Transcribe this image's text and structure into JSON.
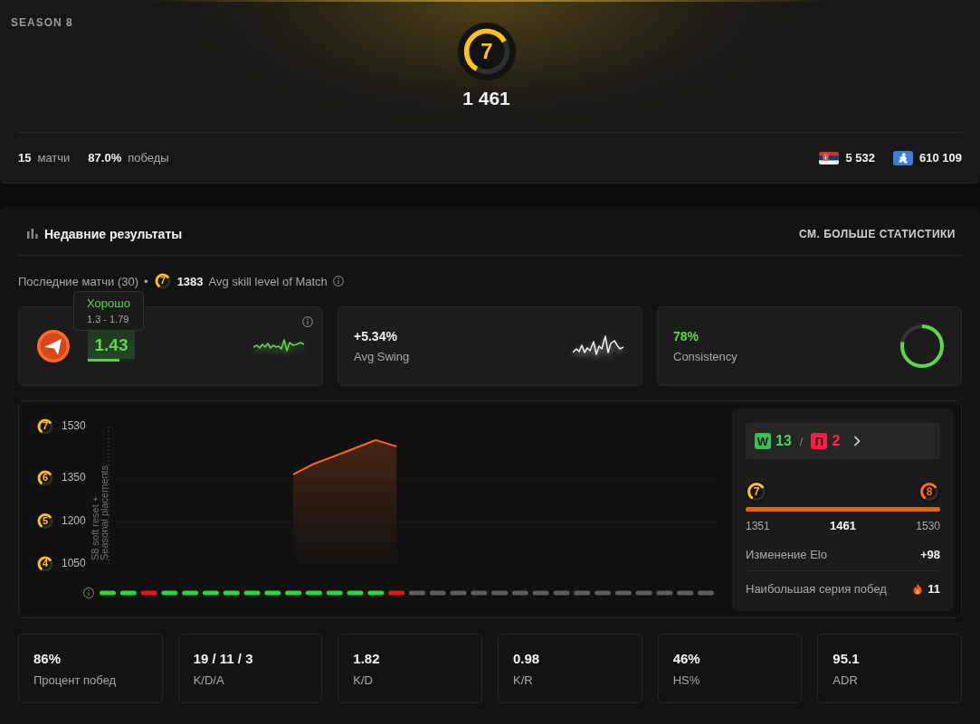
{
  "season_card": {
    "season": "SEASON 8",
    "skill_level": {
      "label": "7",
      "color": "#ffc21a"
    },
    "elo": "1 461",
    "totals": [
      {
        "number": "15",
        "unit": "матчи"
      },
      {
        "number": "87.0%",
        "unit": "победы"
      }
    ],
    "rankings": [
      {
        "kind": "country",
        "value": "5 532"
      },
      {
        "kind": "region",
        "value": "610 109"
      }
    ]
  },
  "recent_results": {
    "title": "Недавние результаты",
    "more_stats_link": "СМ. БОЛЬШЕ СТАТИСТИКИ",
    "summary": {
      "matches_label": "Последние матчи (30)",
      "separator": "•",
      "skill_level": {
        "label": "7",
        "color": "#ffc21a"
      },
      "avg_elo": "1383",
      "avg_label": "Avg skill level of Match"
    },
    "highlight_cards": [
      {
        "kind": "rating",
        "value": "1.43",
        "level": 0.68,
        "tooltip": {
          "title": "Хорошо",
          "range": "1.3 - 1.79"
        }
      },
      {
        "kind": "swing",
        "value": "+5.34%",
        "label": "Avg Swing"
      },
      {
        "kind": "consistency",
        "value": "78%",
        "label": "Consistency",
        "level": 0.78
      }
    ],
    "elo_chart": {
      "tick_levels": [
        {
          "label": "7",
          "color": "#ffc21a"
        },
        {
          "label": "6",
          "color": "#ffc21a"
        },
        {
          "label": "5",
          "color": "#ffc21a"
        },
        {
          "label": "4",
          "color": "#ffc21a"
        }
      ],
      "note_lines": [
        "S8 soft reset +",
        "Seasonal placements"
      ],
      "chart_data": {
        "type": "area",
        "categories": [
          null,
          null,
          null,
          null,
          null,
          null,
          null,
          null,
          null,
          null,
          null,
          null,
          null,
          null,
          null,
          null,
          null,
          null,
          null,
          null,
          null,
          null,
          null,
          null,
          null,
          null,
          null,
          null,
          null,
          null
        ],
        "values": [
          null,
          null,
          null,
          null,
          null,
          null,
          null,
          null,
          null,
          1363,
          1400,
          1427,
          1455,
          1483,
          1461,
          null,
          null,
          null,
          null,
          null,
          null,
          null,
          null,
          null,
          null,
          null,
          null,
          null,
          null,
          null
        ],
        "ylim": [
          1050,
          1530
        ],
        "yticks": [
          {
            "value": 1530,
            "label": "1530"
          },
          {
            "value": 1350,
            "label": "1350"
          },
          {
            "value": 1200,
            "label": "1200"
          },
          {
            "value": 1050,
            "label": "1050"
          }
        ]
      },
      "results": [
        {
          "color": "#27d63a"
        },
        {
          "color": "#27d63a"
        },
        {
          "color": "#e3131c"
        },
        {
          "color": "#27d63a"
        },
        {
          "color": "#27d63a"
        },
        {
          "color": "#27d63a"
        },
        {
          "color": "#27d63a"
        },
        {
          "color": "#27d63a"
        },
        {
          "color": "#27d63a"
        },
        {
          "color": "#27d63a"
        },
        {
          "color": "#27d63a"
        },
        {
          "color": "#27d63a"
        },
        {
          "color": "#27d63a"
        },
        {
          "color": "#27d63a"
        },
        {
          "color": "#e3131c"
        },
        {
          "color": "#5a5d61"
        },
        {
          "color": "#5a5d61"
        },
        {
          "color": "#5a5d61"
        },
        {
          "color": "#5a5d61"
        },
        {
          "color": "#5a5d61"
        },
        {
          "color": "#5a5d61"
        },
        {
          "color": "#5a5d61"
        },
        {
          "color": "#5a5d61"
        },
        {
          "color": "#5a5d61"
        },
        {
          "color": "#5a5d61"
        },
        {
          "color": "#5a5d61"
        },
        {
          "color": "#5a5d61"
        },
        {
          "color": "#5a5d61"
        },
        {
          "color": "#5a5d61"
        },
        {
          "color": "#5a5d61"
        }
      ]
    },
    "record_panel": {
      "record": [
        {
          "kind": "win",
          "letter": "W",
          "count": "13"
        },
        {
          "kind": "loss",
          "letter": "П",
          "count": "2"
        }
      ],
      "separator": "/",
      "level_range": {
        "from": {
          "label": "7",
          "color": "#ffc21a"
        },
        "to": {
          "label": "8",
          "color": "#ff6a13"
        },
        "min": "1351",
        "current": "1461",
        "max": "1530"
      },
      "rows": [
        {
          "kind": "plain",
          "label": "Изменение Elo",
          "value": "+98"
        },
        {
          "kind": "streak",
          "label": "Наибольшая серия побед",
          "value": "11"
        }
      ]
    },
    "stats": [
      {
        "value": "86%",
        "label": "Процент побед"
      },
      {
        "value": "19 / 11 / 3",
        "label": "K/D/A"
      },
      {
        "value": "1.82",
        "label": "K/D"
      },
      {
        "value": "0.98",
        "label": "K/R"
      },
      {
        "value": "46%",
        "label": "HS%"
      },
      {
        "value": "95.1",
        "label": "ADR"
      }
    ]
  }
}
